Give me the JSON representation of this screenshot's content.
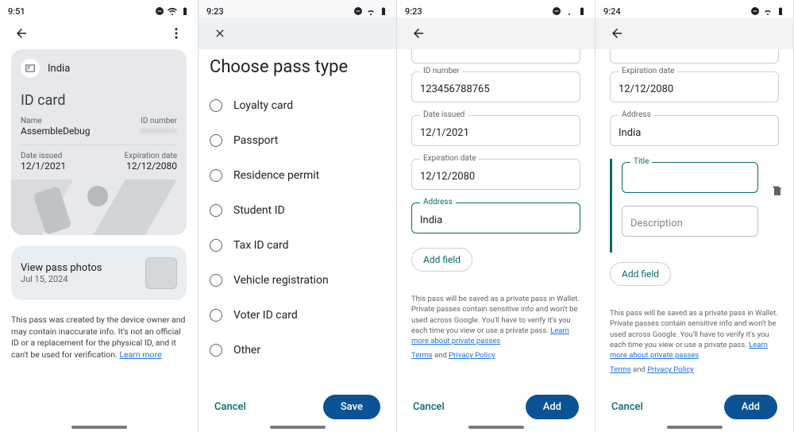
{
  "s1": {
    "time": "9:51",
    "country": "India",
    "card_title": "ID card",
    "name_label": "Name",
    "name_value": "AssembleDebug",
    "idnum_label": "ID number",
    "idnum_value": "•••••••••",
    "issued_label": "Date issued",
    "issued_value": "12/1/2021",
    "exp_label": "Expiration date",
    "exp_value": "12/12/2080",
    "view_photos": "View pass photos",
    "photos_date": "Jul 15, 2024",
    "disclaimer": "This pass was created by the device owner and may contain inaccurate info. It's not an official ID or a replacement for the physical ID, and it can't be used for verification. ",
    "learn_more": "Learn more"
  },
  "s2": {
    "time": "9:23",
    "title": "Choose pass type",
    "options": [
      "Loyalty card",
      "Passport",
      "Residence permit",
      "Student ID",
      "Tax ID card",
      "Vehicle registration",
      "Voter ID card",
      "Other"
    ],
    "cancel": "Cancel",
    "save": "Save"
  },
  "s3": {
    "time": "9:23",
    "idnum_label": "ID number",
    "idnum_value": "123456788765",
    "issued_label": "Date issued",
    "issued_value": "12/1/2021",
    "exp_label": "Expiration date",
    "exp_value": "12/12/2080",
    "addr_label": "Address",
    "addr_value": "India",
    "add_field": "Add field",
    "notice": "This pass will be saved as a private pass in Wallet. Private passes contain sensitive info and won't be used across Google. You'll have to verify it's you each time you view or use a private pass. ",
    "learn_private": "Learn more about private passes",
    "terms": "Terms",
    "and": " and ",
    "privacy": "Privacy Policy",
    "cancel": "Cancel",
    "add": "Add"
  },
  "s4": {
    "time": "9:24",
    "exp_label": "Expiration date",
    "exp_value": "12/12/2080",
    "addr_label": "Address",
    "addr_value": "India",
    "title_label": "Title",
    "title_value": "",
    "desc_placeholder": "Description",
    "add_field": "Add field",
    "cancel": "Cancel",
    "add": "Add"
  }
}
